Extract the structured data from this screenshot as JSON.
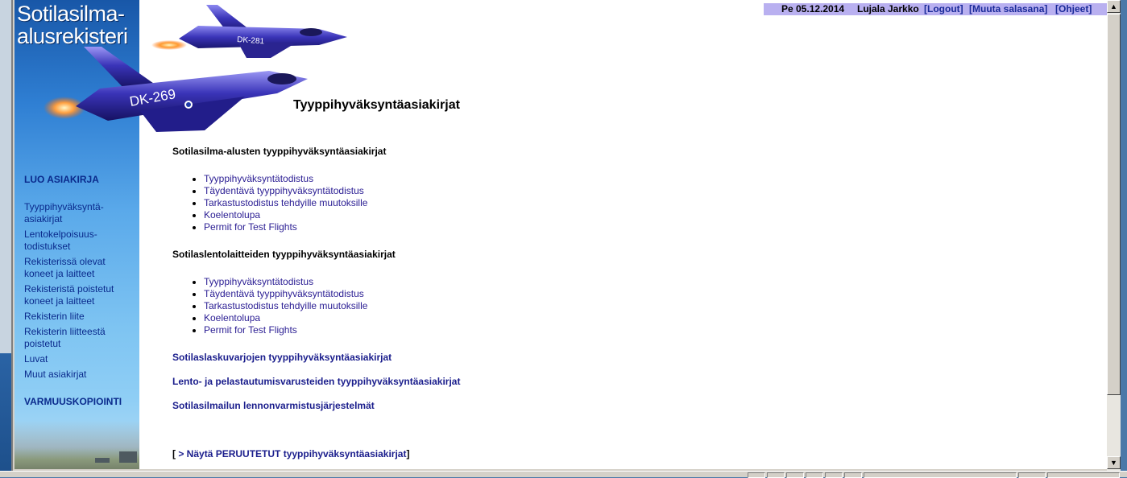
{
  "sidebar": {
    "logo_line1": "Sotilasilma-",
    "logo_line2": "alusrekisteri",
    "jet_small_label": "DK-281",
    "jet_large_label": "DK-269",
    "create_heading": "LUO ASIAKIRJA",
    "items": [
      {
        "label": "Tyyppihyväksyntä-asiakirjat",
        "line1": "Tyyppihyväksyntä-",
        "line2": "asiakirjat"
      },
      {
        "label": "Lentokelpoisuus-todistukset",
        "line1": "Lentokelpoisuus-",
        "line2": "todistukset"
      },
      {
        "label": "Rekisterissä olevat koneet ja laitteet",
        "line1": "Rekisterissä olevat",
        "line2": "koneet ja laitteet"
      },
      {
        "label": "Rekisteristä poistetut koneet ja laitteet",
        "line1": "Rekisteristä poistetut",
        "line2": "koneet ja laitteet"
      },
      {
        "label": "Rekisterin liite",
        "line1": "Rekisterin liite",
        "line2": ""
      },
      {
        "label": "Rekisterin liitteestä poistetut",
        "line1": "Rekisterin liitteestä",
        "line2": "poistetut"
      },
      {
        "label": "Luvat",
        "line1": "Luvat",
        "line2": ""
      },
      {
        "label": "Muut asiakirjat",
        "line1": "Muut asiakirjat",
        "line2": ""
      }
    ],
    "backup_heading": "VARMUUSKOPIOINTI"
  },
  "header": {
    "date": "Pe 05.12.2014",
    "user": "Lujala Jarkko",
    "logout": "[Logout]",
    "change_password": "[Muuta salasana]",
    "help": "[Ohjeet]"
  },
  "main": {
    "title": "Tyyppihyväksyntäasiakirjat",
    "section1": {
      "title": "Sotilasilma-alusten tyyppihyväksyntäasiakirjat",
      "items": [
        "Tyyppihyväksyntätodistus",
        "Täydentävä tyyppihyväksyntätodistus",
        "Tarkastustodistus tehdyille muutoksille",
        "Koelentolupa",
        "Permit for Test Flights"
      ]
    },
    "section2": {
      "title": "Sotilaslentolaitteiden tyyppihyväksyntäasiakirjat",
      "items": [
        "Tyyppihyväksyntätodistus",
        "Täydentävä tyyppihyväksyntätodistus",
        "Tarkastustodistus tehdyille muutoksille",
        "Koelentolupa",
        "Permit for Test Flights"
      ]
    },
    "links": [
      "Sotilaslaskuvarjojen tyyppihyväksyntäasiakirjat",
      "Lento- ja pelastautumisvarusteiden tyyppihyväksyntäasiakirjat",
      "Sotilasilmailun lennonvarmistusjärjestelmät"
    ],
    "show_cancelled_open": "[",
    "show_cancelled_link": "> Näytä PERUUTETUT tyyppihyväksyntäasiakirjat",
    "show_cancelled_close": "]"
  },
  "colors": {
    "userbar_bg": "#b9b0f0",
    "link": "#2a1d93",
    "nav_link": "#0a2a8c",
    "jet_body": "#3a34b8"
  }
}
